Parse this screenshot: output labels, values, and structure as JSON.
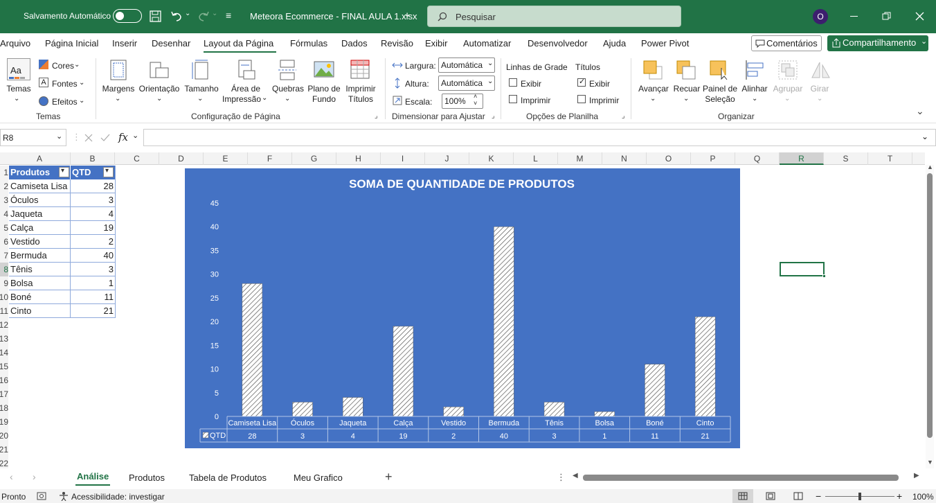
{
  "titlebar": {
    "autosave_label": "Salvamento Automático",
    "filename": "Meteora Ecommerce - FINAL AULA 1.xlsx",
    "search_placeholder": "Pesquisar",
    "avatar_letter": "O"
  },
  "menu": {
    "tabs": [
      "Arquivo",
      "Página Inicial",
      "Inserir",
      "Desenhar",
      "Layout da Página",
      "Fórmulas",
      "Dados",
      "Revisão",
      "Exibir",
      "Automatizar",
      "Desenvolvedor",
      "Ajuda",
      "Power Pivot"
    ],
    "comments": "Comentários",
    "share": "Compartilhamento"
  },
  "ribbon": {
    "temas": {
      "button": "Temas",
      "cores": "Cores",
      "fontes": "Fontes",
      "efeitos": "Efeitos",
      "group": "Temas"
    },
    "config": {
      "margens": "Margens",
      "orientacao": "Orientação",
      "tamanho": "Tamanho",
      "area_l1": "Área de",
      "area_l2": "Impressão",
      "quebras": "Quebras",
      "plano_l1": "Plano de",
      "plano_l2": "Fundo",
      "imprimir_l1": "Imprimir",
      "imprimir_l2": "Títulos",
      "group": "Configuração de Página"
    },
    "dimensionar": {
      "largura": "Largura:",
      "largura_val": "Automática",
      "altura": "Altura:",
      "altura_val": "Automática",
      "escala": "Escala:",
      "escala_val": "100%",
      "group": "Dimensionar para Ajustar"
    },
    "opcoes": {
      "linhas": "Linhas de Grade",
      "titulos": "Títulos",
      "exibir": "Exibir",
      "imprimir": "Imprimir",
      "group": "Opções de Planilha"
    },
    "organizar": {
      "avancar": "Avançar",
      "recuar": "Recuar",
      "painel_l1": "Painel de",
      "painel_l2": "Seleção",
      "alinhar": "Alinhar",
      "agrupar": "Agrupar",
      "girar": "Girar",
      "group": "Organizar"
    }
  },
  "formula_bar": {
    "name_box": "R8",
    "fx": "fx",
    "value": ""
  },
  "columns": [
    "A",
    "B",
    "C",
    "D",
    "E",
    "F",
    "G",
    "H",
    "I",
    "J",
    "K",
    "L",
    "M",
    "N",
    "O",
    "P",
    "Q",
    "R",
    "S",
    "T"
  ],
  "rows": [
    "1",
    "2",
    "3",
    "4",
    "5",
    "6",
    "7",
    "8",
    "9",
    "10",
    "11",
    "12",
    "13",
    "14",
    "15",
    "16",
    "17",
    "18",
    "19",
    "20",
    "21",
    "22"
  ],
  "table": {
    "header": [
      "Produtos",
      "QTD"
    ],
    "rows": [
      [
        "Camiseta Lisa",
        "28"
      ],
      [
        "Óculos",
        "3"
      ],
      [
        "Jaqueta",
        "4"
      ],
      [
        "Calça",
        "19"
      ],
      [
        "Vestido",
        "2"
      ],
      [
        "Bermuda",
        "40"
      ],
      [
        "Tênis",
        "3"
      ],
      [
        "Bolsa",
        "1"
      ],
      [
        "Boné",
        "11"
      ],
      [
        "Cinto",
        "21"
      ]
    ]
  },
  "chart_data": {
    "type": "bar",
    "title": "SOMA DE QUANTIDADE DE PRODUTOS",
    "categories": [
      "Camiseta Lisa",
      "Óculos",
      "Jaqueta",
      "Calça",
      "Vestido",
      "Bermuda",
      "Tênis",
      "Bolsa",
      "Boné",
      "Cinto"
    ],
    "series": [
      {
        "name": "QTD",
        "values": [
          28,
          3,
          4,
          19,
          2,
          40,
          3,
          1,
          11,
          21
        ]
      }
    ],
    "yticks": [
      "0",
      "5",
      "10",
      "15",
      "20",
      "25",
      "30",
      "35",
      "40",
      "45"
    ],
    "ylim": [
      0,
      45
    ],
    "grid": false,
    "data_table": true,
    "background": "#4472C4",
    "bar_fill": "diagonal-hatch white"
  },
  "sheet_tabs": [
    "Análise",
    "Produtos",
    "Tabela de Produtos",
    "Meu Grafico"
  ],
  "active_tab": "Análise",
  "status": {
    "ready": "Pronto",
    "accessibility": "Acessibilidade: investigar",
    "zoom": "100%"
  },
  "colors": {
    "excel_green": "#217346",
    "chart_blue": "#4472C4",
    "table_header": "#4472C4"
  }
}
